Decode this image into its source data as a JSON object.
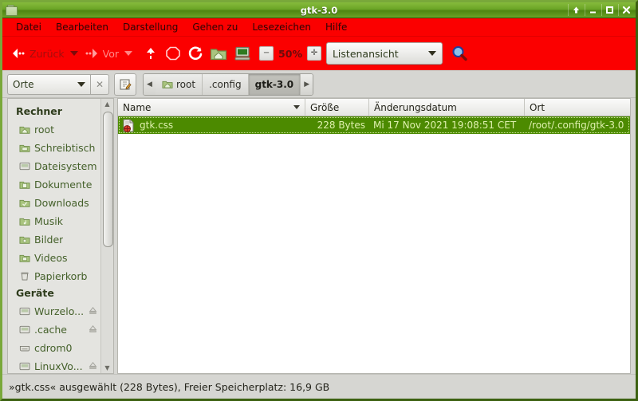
{
  "window": {
    "title": "gtk-3.0",
    "icon": "folder-icon",
    "controls": [
      {
        "name": "shade-button",
        "glyph": "↑"
      },
      {
        "name": "minimize-button",
        "glyph": "_"
      },
      {
        "name": "maximize-button",
        "glyph": "□"
      },
      {
        "name": "close-button",
        "glyph": "✕"
      }
    ]
  },
  "menubar": {
    "items": [
      {
        "label": "Datei"
      },
      {
        "label": "Bearbeiten"
      },
      {
        "label": "Darstellung"
      },
      {
        "label": "Gehen zu"
      },
      {
        "label": "Lesezeichen"
      },
      {
        "label": "Hilfe"
      }
    ]
  },
  "toolbar": {
    "back_label": "Zurück",
    "forward_label": "Vor",
    "up_icon": "arrow-up-icon",
    "stop_icon": "stop-icon",
    "reload_icon": "reload-icon",
    "home_icon": "home-folder-icon",
    "computer_icon": "computer-icon",
    "zoom_out_glyph": "−",
    "zoom_level": "50%",
    "zoom_in_glyph": "✛",
    "view_mode": "Listenansicht",
    "search_icon": "search-icon"
  },
  "pathbar": {
    "edit_path_icon": "edit-path-icon",
    "prev_glyph": "◀",
    "next_glyph": "▶",
    "crumbs": [
      {
        "label": "root",
        "icon": "home-folder-icon",
        "active": false
      },
      {
        "label": ".config",
        "icon": "",
        "active": false
      },
      {
        "label": "gtk-3.0",
        "icon": "",
        "active": true
      }
    ]
  },
  "sidebar": {
    "selector_label": "Orte",
    "clear_glyph": "✕",
    "groups": [
      {
        "title": "Rechner",
        "items": [
          {
            "label": "root",
            "icon": "home-folder-icon",
            "eject": false
          },
          {
            "label": "Schreibtisch",
            "icon": "desktop-folder-icon",
            "eject": false
          },
          {
            "label": "Dateisystem",
            "icon": "drive-icon",
            "eject": false
          },
          {
            "label": "Dokumente",
            "icon": "documents-folder-icon",
            "eject": false
          },
          {
            "label": "Downloads",
            "icon": "downloads-folder-icon",
            "eject": false
          },
          {
            "label": "Musik",
            "icon": "music-folder-icon",
            "eject": false
          },
          {
            "label": "Bilder",
            "icon": "pictures-folder-icon",
            "eject": false
          },
          {
            "label": "Videos",
            "icon": "videos-folder-icon",
            "eject": false
          },
          {
            "label": "Papierkorb",
            "icon": "trash-icon",
            "eject": false
          }
        ]
      },
      {
        "title": "Geräte",
        "items": [
          {
            "label": "Wurzelo...",
            "icon": "drive-icon",
            "eject": true
          },
          {
            "label": ".cache",
            "icon": "drive-icon",
            "eject": true
          },
          {
            "label": "cdrom0",
            "icon": "cdrom-icon",
            "eject": false
          },
          {
            "label": "LinuxVo...",
            "icon": "drive-icon",
            "eject": true
          }
        ]
      }
    ]
  },
  "filelist": {
    "columns": [
      {
        "label": "Name",
        "sorted": true
      },
      {
        "label": "Größe",
        "sorted": false
      },
      {
        "label": "Änderungsdatum",
        "sorted": false
      },
      {
        "label": "Ort",
        "sorted": false
      }
    ],
    "rows": [
      {
        "icon": "css-file-icon",
        "name": "gtk.css",
        "size": "228 Bytes",
        "modified": "Mi 17 Nov 2021 19:08:51 CET",
        "location": "/root/.config/gtk-3.0",
        "selected": true
      }
    ]
  },
  "statusbar": {
    "text": "»gtk.css« ausgewählt (228 Bytes), Freier Speicherplatz: 16,9  GB"
  },
  "colors": {
    "toolbar_red": "#fb0000",
    "titlebar_green": "#6ba426",
    "selection_green": "#4c8a00",
    "selection_text": "#dff0ae",
    "chrome_grey": "#d6d6d2"
  }
}
